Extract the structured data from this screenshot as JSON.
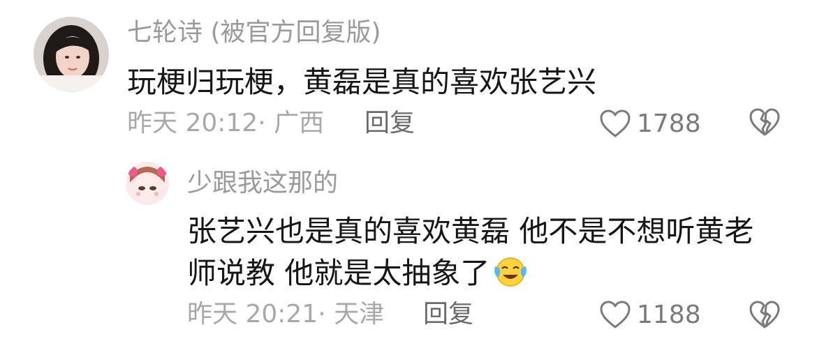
{
  "comments": [
    {
      "username": "七轮诗 (被官方回复版)",
      "content": "玩梗归玩梗，黄磊是真的喜欢张艺兴",
      "meta": "昨天 20:12· 广西",
      "reply_label": "回复",
      "likes": "1788",
      "avatar_icon": "user-avatar-photo"
    }
  ],
  "replies": [
    {
      "username": "少跟我这那的",
      "content": "张艺兴也是真的喜欢黄磊 他不是不想听黄老师说教 他就是太抽象了",
      "emoji": "crying-laughing-emoji",
      "meta": "昨天 20:21· 天津",
      "reply_label": "回复",
      "likes": "1188",
      "avatar_icon": "anime-avatar"
    }
  ],
  "icons": {
    "like": "heart-outline-icon",
    "dislike": "broken-heart-icon"
  }
}
